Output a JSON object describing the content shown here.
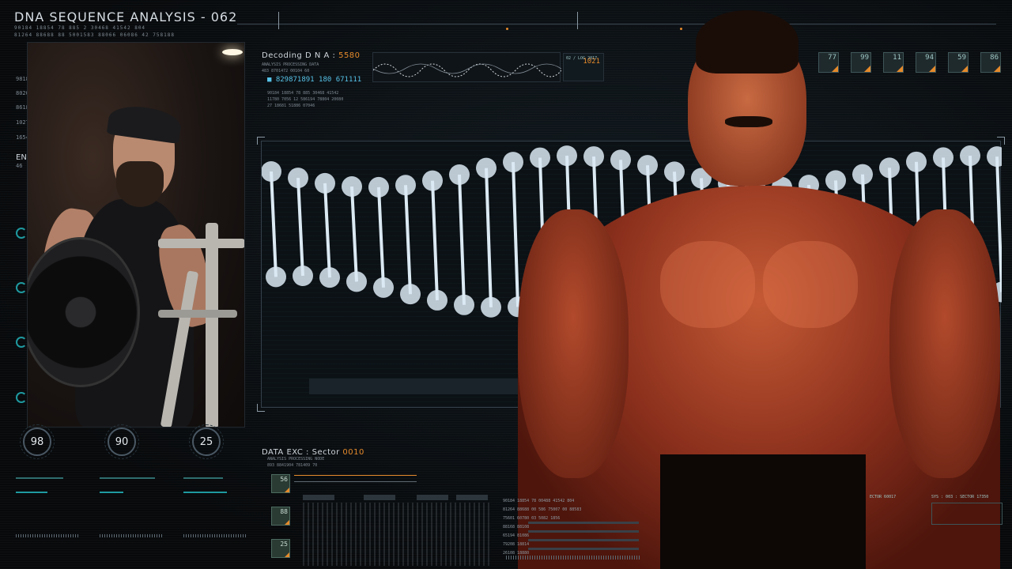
{
  "header": {
    "title": "DNA SEQUENCE ANALYSIS - 062",
    "line1": "90184 18854 78 885 2 30468 41542 804",
    "line2": "81264 88688 88 5001583 88066 06086 42 758188"
  },
  "side_numbers": [
    "9818",
    "8020",
    "8618",
    "1027",
    "1654"
  ],
  "side_label": "EN",
  "side_sub": "46",
  "gauges": [
    {
      "value": "98"
    },
    {
      "value": "90"
    },
    {
      "value": "25"
    }
  ],
  "decoding": {
    "label": "Decoding D N A : ",
    "value": "5580",
    "sub": "ANALYSIS PROCESSING DATA",
    "sub2": "483 8701472 00104 60",
    "big": "■ 829871891 180 671111",
    "row1": "90184 18854 78 885 30468 41542",
    "row2": "11780 7056 12 586194 78804 20080",
    "row3": "27 18681 51886 07046"
  },
  "wave_panel": {
    "header": "02 / LOG 2017",
    "value": "1021"
  },
  "badges": [
    {
      "value": "77"
    },
    {
      "value": "99"
    },
    {
      "value": "11"
    },
    {
      "value": "94"
    },
    {
      "value": "59"
    },
    {
      "value": "86"
    }
  ],
  "data_exc": {
    "label": "DATA EXC : Sector ",
    "value": "0010",
    "sub": "ANALYSIS PROCESSING NODE",
    "sub2": "893 8841904 781409 70"
  },
  "tiles": [
    {
      "value": "56"
    },
    {
      "value": "88"
    },
    {
      "value": "25"
    }
  ],
  "stats": {
    "row1": "90184 18854 78 00488 41542 804",
    "row2": "81264 88688 00 586 75007 00 88583",
    "row3": "75601 60780 03 5082 1856",
    "row4": "88168 88108",
    "row5": "65194 81086",
    "row6": "79208 18814",
    "row7": "26108 18880"
  },
  "right_bottom": {
    "sector": "ECTOR 60017",
    "sys": "SYS : 003 : SECTOR 17350"
  },
  "colors": {
    "accent": "#e58a2b",
    "teal": "#1e9aa0",
    "dna": "#dbe9f3"
  }
}
